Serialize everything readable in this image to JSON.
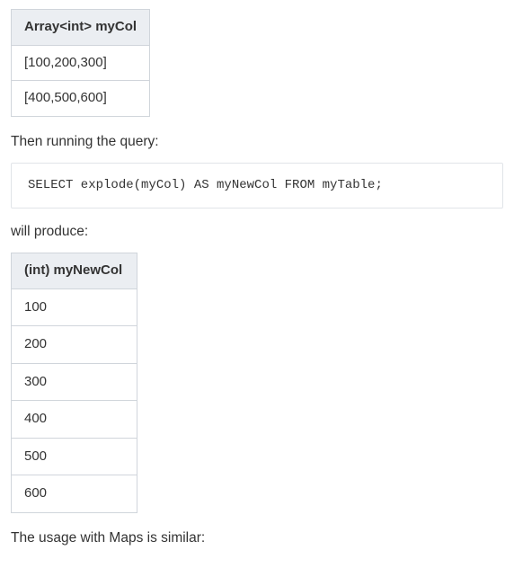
{
  "table1": {
    "header": "Array<int> myCol",
    "rows": [
      "[100,200,300]",
      "[400,500,600]"
    ]
  },
  "text": {
    "then_running": "Then running the query:",
    "will_produce": "will produce:",
    "maps_similar": "The usage with Maps is similar:"
  },
  "code": {
    "query": "SELECT explode(myCol) AS myNewCol FROM myTable;"
  },
  "table2": {
    "header": "(int) myNewCol",
    "rows": [
      "100",
      "200",
      "300",
      "400",
      "500",
      "600"
    ]
  }
}
